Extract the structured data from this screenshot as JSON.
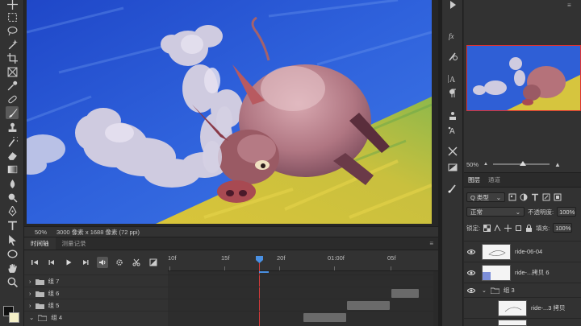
{
  "canvas_status": {
    "zoom": "50%",
    "doc_info": "3000 像素 x 1688 像素 (72 ppi)"
  },
  "timeline": {
    "tabs": [
      {
        "label": "时间轴",
        "active": true
      },
      {
        "label": "测量记录",
        "active": false
      }
    ],
    "ruler_labels": [
      "10f",
      "15f",
      "20f",
      "01:00f",
      "05f"
    ],
    "layers": [
      {
        "name": "组 7"
      },
      {
        "name": "组 6"
      },
      {
        "name": "组 5"
      },
      {
        "name": "组 4"
      }
    ]
  },
  "navigator": {
    "zoom": "50%"
  },
  "layers_panel": {
    "tabs": [
      {
        "label": "图层",
        "active": true
      },
      {
        "label": "通道",
        "active": false
      }
    ],
    "filter_label": "Q 类型",
    "blend_mode": "正常",
    "opacity_label": "不透明度:",
    "opacity_value": "100%",
    "lock_label": "锁定:",
    "fill_label": "填充:",
    "fill_value": "100%",
    "items": [
      {
        "name": "ride-06-04",
        "type": "layer"
      },
      {
        "name": "ride-...拷贝 6",
        "type": "layer"
      },
      {
        "name": "组 3",
        "type": "group"
      },
      {
        "name": "ride-...3 拷贝",
        "type": "layer"
      }
    ]
  },
  "colors": {
    "sky": "#2f5fd6",
    "hill": "#d8c83a",
    "pig": "#b5727a",
    "accent_red": "#d23a3a"
  },
  "icons": [
    "move-icon",
    "marquee-icon",
    "lasso-icon",
    "magic-wand-icon",
    "crop-icon",
    "frame-icon",
    "eyedropper-icon",
    "healing-icon",
    "brush-icon",
    "stamp-icon",
    "history-brush-icon",
    "eraser-icon",
    "gradient-icon",
    "blur-icon",
    "dodge-icon",
    "pen-icon",
    "type-icon",
    "path-select-icon",
    "ellipse-icon",
    "hand-icon",
    "zoom-icon"
  ]
}
